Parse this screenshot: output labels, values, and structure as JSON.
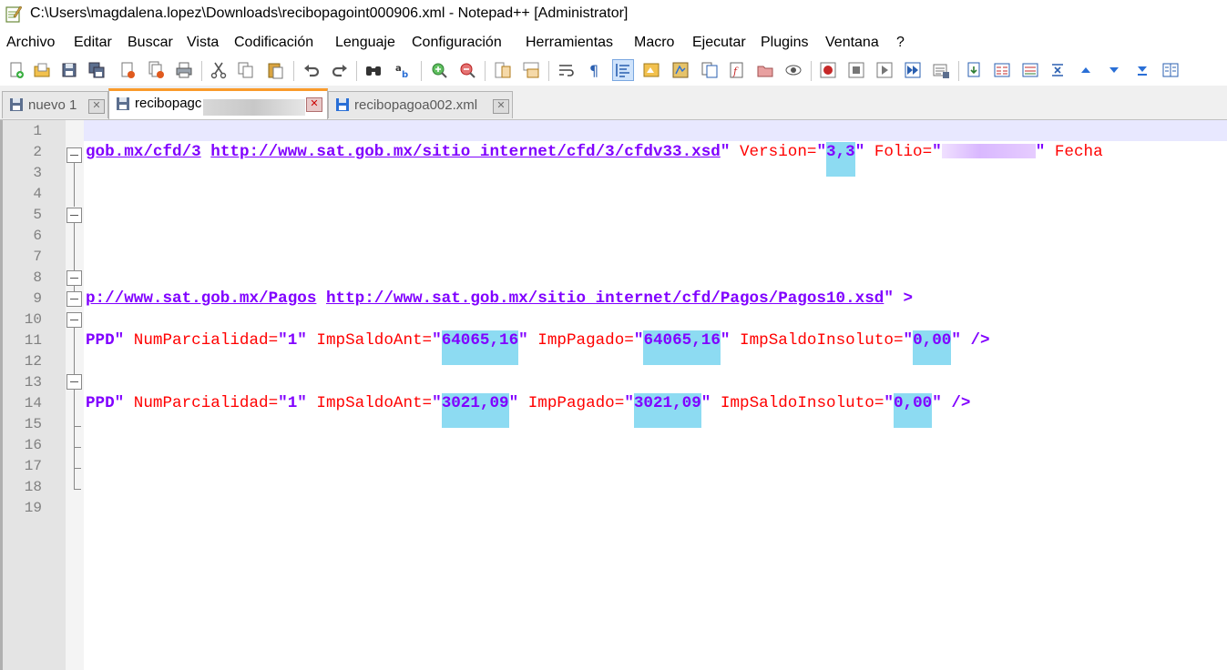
{
  "window": {
    "title": "C:\\Users\\magdalena.lopez\\Downloads\\recibopagoint000906.xml - Notepad++ [Administrator]",
    "app_icon": "notepadpp-icon"
  },
  "menu": [
    "Archivo",
    "Editar",
    "Buscar",
    "Vista",
    "Codificación",
    "Lenguaje",
    "Configuración",
    "Herramientas",
    "Macro",
    "Ejecutar",
    "Plugins",
    "Ventana",
    "?"
  ],
  "toolbar": {
    "icons": [
      "new-file-icon",
      "open-file-icon",
      "save-icon",
      "save-all-icon",
      "close-icon",
      "close-all-icon",
      "print-icon",
      "cut-icon",
      "copy-icon",
      "paste-icon",
      "undo-icon",
      "redo-icon",
      "find-icon",
      "replace-icon",
      "zoom-in-icon",
      "zoom-out-icon",
      "sync-vertical-icon",
      "sync-horizontal-icon",
      "word-wrap-icon",
      "show-all-chars-icon",
      "indent-guide-icon",
      "udl-icon",
      "doc-map-icon",
      "doc-list-icon",
      "function-list-icon",
      "folder-workspace-icon",
      "monitor-icon",
      "record-macro-icon",
      "stop-macro-icon",
      "play-macro-icon",
      "run-macro-multiple-icon",
      "save-macro-icon",
      "xml-check-icon",
      "compare-icon",
      "compare-lines-icon",
      "fold-icon",
      "nav-up-icon",
      "nav-down-icon",
      "nav-last-icon",
      "panel-icon"
    ]
  },
  "tabs": [
    {
      "label": "nuevo 1",
      "active": false
    },
    {
      "label": "recibopagc",
      "active": true
    },
    {
      "label": "recibopagoa002.xml",
      "active": false
    }
  ],
  "editor": {
    "line_numbers": [
      "1",
      "2",
      "3",
      "4",
      "5",
      "6",
      "7",
      "8",
      "9",
      "10",
      "11",
      "12",
      "13",
      "14",
      "15",
      "16",
      "17",
      "18",
      "19"
    ],
    "line2": {
      "u1": "gob.mx/cfd/3",
      "u2": "http://www.sat.gob.mx/sitio_internet/cfd/3/cfdv33.xsd",
      "q1": "\"",
      "attr_version": "Version=",
      "version_value": "3,3",
      "attr_folio": "Folio=",
      "folio_trail": "\"",
      "attr_fecha": "Fecha"
    },
    "line9": {
      "u1": "p://www.sat.gob.mx/Pagos",
      "u2": "http://www.sat.gob.mx/sitio_internet/cfd/Pagos/Pagos10.xsd",
      "tail": "\" >"
    },
    "line11": {
      "ppd": "PPD\"",
      "attr1": "NumParcialidad=",
      "val1": "\"1\"",
      "attr2": "ImpSaldoAnt=",
      "val2": "64065,16",
      "attr3": "ImpPagado=",
      "val3": "64065,16",
      "attr4": "ImpSaldoInsoluto=",
      "val4": "0,00",
      "end": "/>"
    },
    "line14": {
      "ppd": "PPD\"",
      "attr1": "NumParcialidad=",
      "val1": "\"1\"",
      "attr2": "ImpSaldoAnt=",
      "val2": "3021,09",
      "attr3": "ImpPagado=",
      "val3": "3021,09",
      "attr4": "ImpSaldoInsoluto=",
      "val4": "0,00",
      "end": "/>"
    }
  },
  "colors": {
    "tab_active_accent": "#fa9b2b",
    "highlight": "#8ddbf2",
    "attribute": "#ff0000",
    "value": "#8000ff",
    "current_line": "#e8e8ff"
  }
}
